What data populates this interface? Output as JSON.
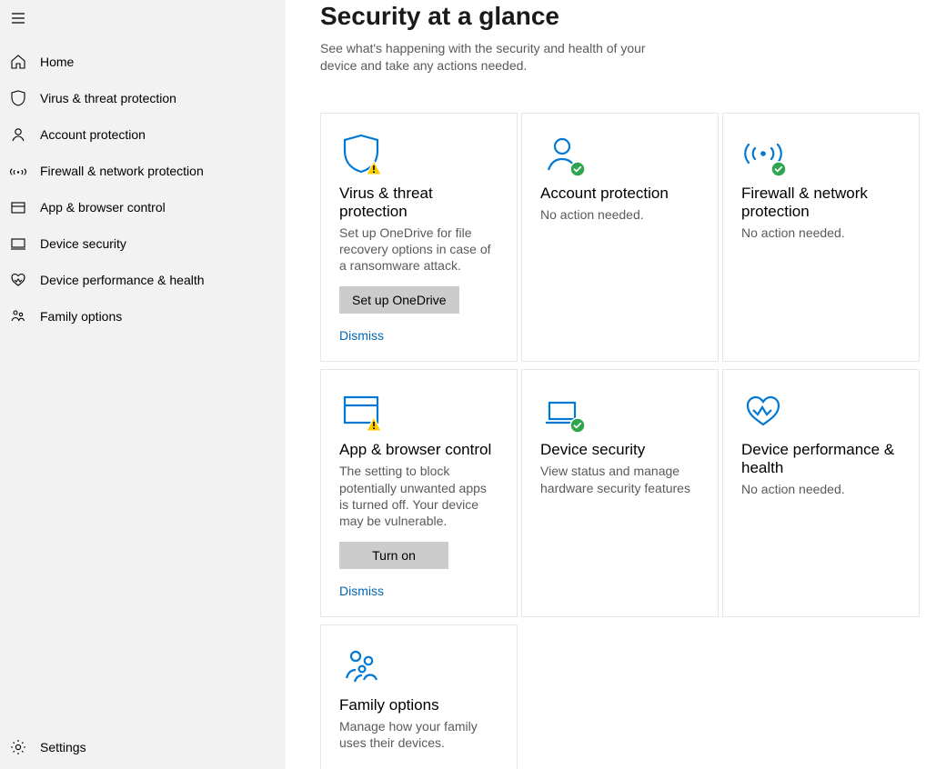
{
  "colors": {
    "accent": "#0078d4",
    "ok": "#2ea44f",
    "warn_fill": "#ffcc00",
    "warn_stroke": "#000000",
    "link": "#0066b4"
  },
  "sidebar": {
    "items": [
      {
        "icon": "home-icon",
        "label": "Home"
      },
      {
        "icon": "shield-icon",
        "label": "Virus & threat protection"
      },
      {
        "icon": "person-icon",
        "label": "Account protection"
      },
      {
        "icon": "network-icon",
        "label": "Firewall & network protection"
      },
      {
        "icon": "browser-icon",
        "label": "App & browser control"
      },
      {
        "icon": "device-icon",
        "label": "Device security"
      },
      {
        "icon": "heart-icon",
        "label": "Device performance & health"
      },
      {
        "icon": "family-icon",
        "label": "Family options"
      }
    ],
    "settings_label": "Settings"
  },
  "main": {
    "title": "Security at a glance",
    "subtitle": "See what's happening with the security and health of your device and take any actions needed.",
    "cards": [
      {
        "title": "Virus & threat protection",
        "desc": "Set up OneDrive for file recovery options in case of a ransomware attack.",
        "button": "Set up OneDrive",
        "link": "Dismiss",
        "status": "warn"
      },
      {
        "title": "Account protection",
        "desc": "No action needed.",
        "status": "ok"
      },
      {
        "title": "Firewall & network protection",
        "desc": "No action needed.",
        "status": "ok"
      },
      {
        "title": "App & browser control",
        "desc": "The setting to block potentially unwanted apps is turned off. Your device may be vulnerable.",
        "button": "Turn on",
        "link": "Dismiss",
        "status": "warn"
      },
      {
        "title": "Device security",
        "desc": "View status and manage hardware security features",
        "status": "ok"
      },
      {
        "title": "Device performance & health",
        "desc": "No action needed.",
        "status": "none"
      },
      {
        "title": "Family options",
        "desc": "Manage how your family uses their devices.",
        "status": "none"
      }
    ]
  }
}
